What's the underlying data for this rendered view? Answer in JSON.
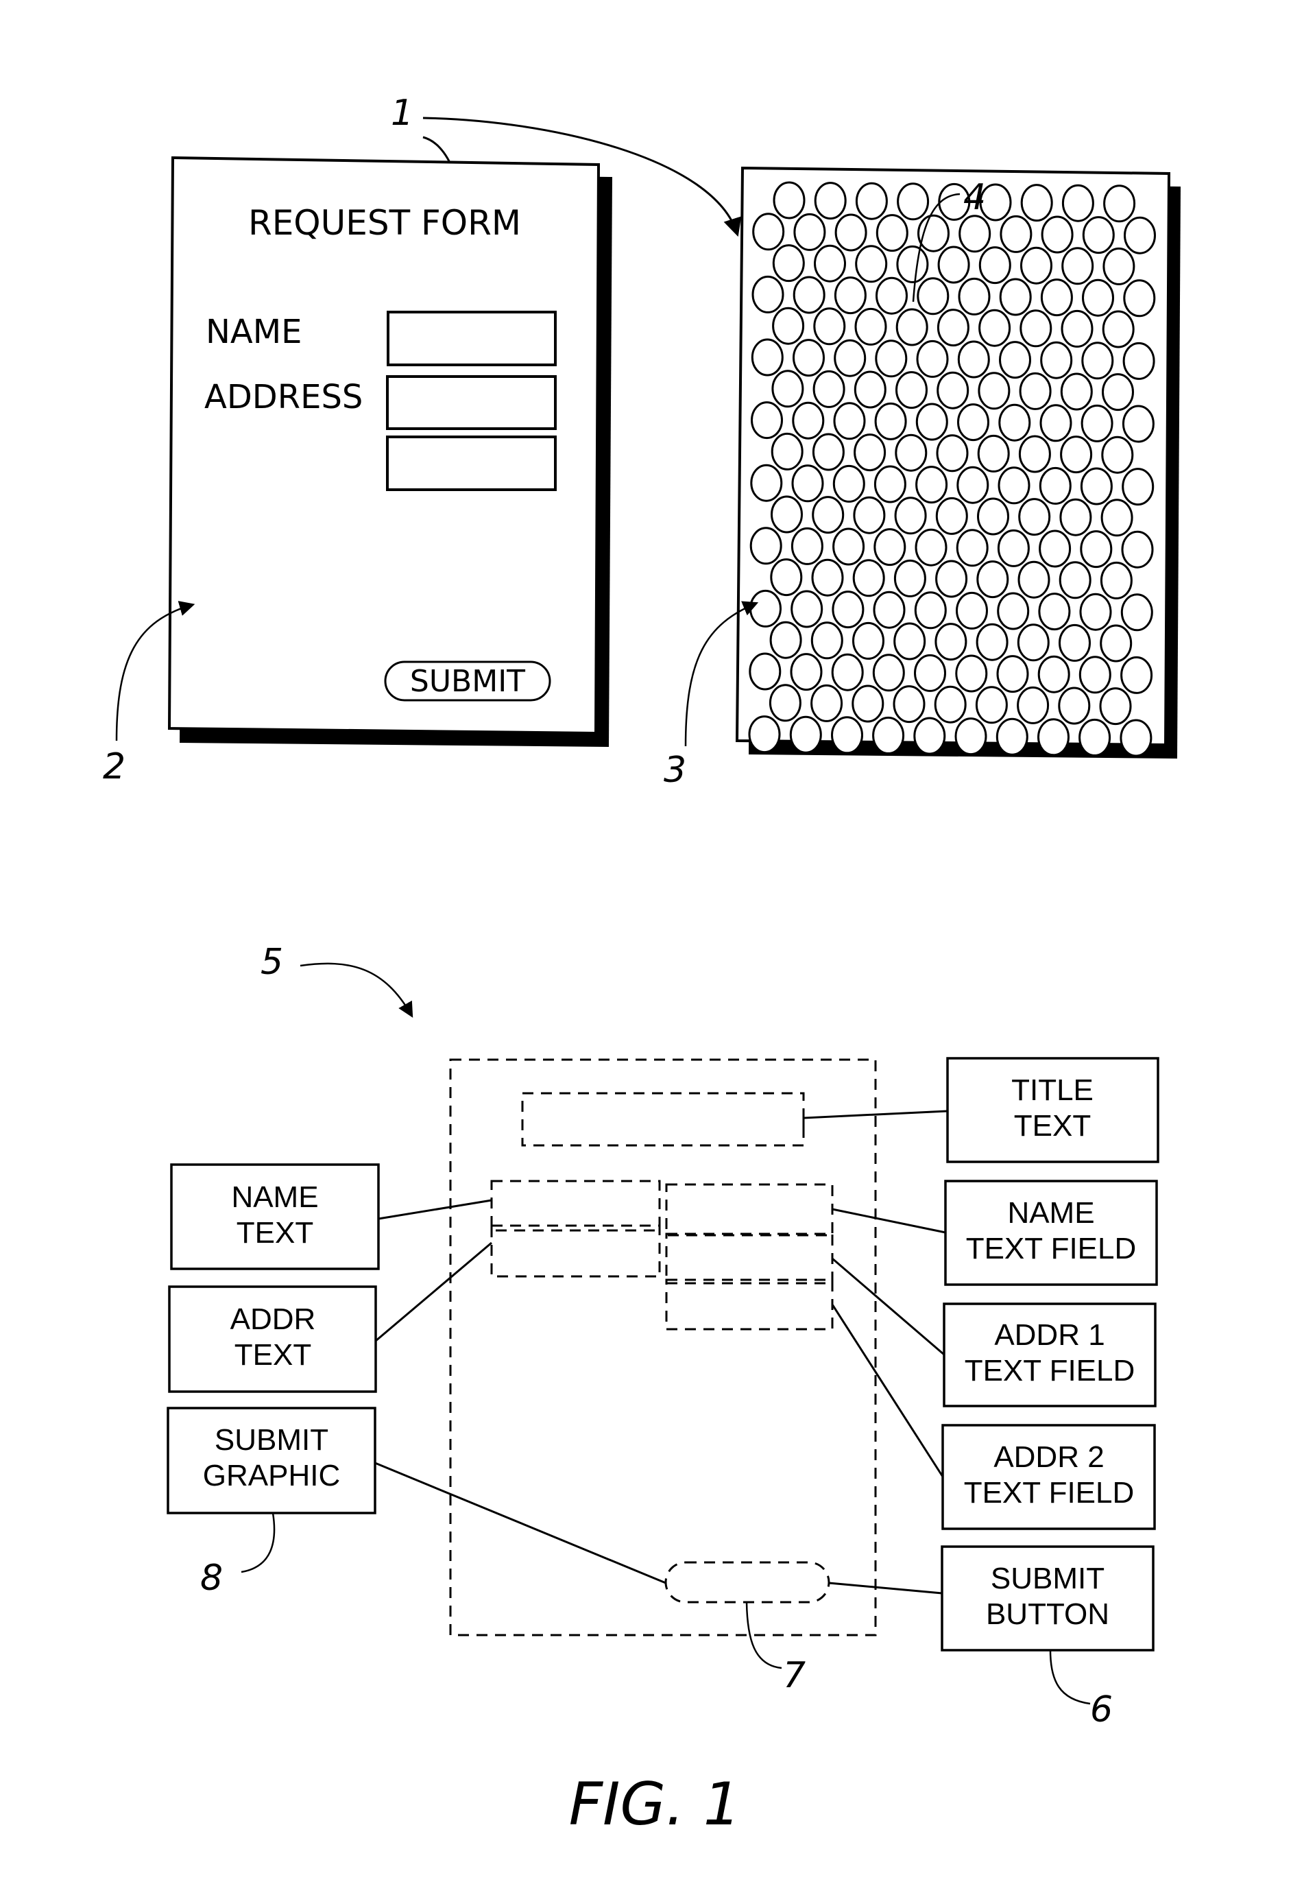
{
  "figure_label": "FIG. 1",
  "reference_numerals": {
    "forms_set": "1",
    "request_form": "2",
    "coded_page": "3",
    "coded_dot": "4",
    "form_layout": "5",
    "submit_button_ref": "6",
    "submit_zone_ref": "7",
    "submit_graphic_ref": "8"
  },
  "request_form": {
    "title": "REQUEST FORM",
    "name_label": "NAME",
    "address_label": "ADDRESS",
    "name_value": "",
    "address_line1_value": "",
    "address_line2_value": "",
    "submit_label": "SUBMIT"
  },
  "dot_pattern": {
    "rows": 18,
    "odd_row_count": 9,
    "even_row_count": 10
  },
  "layout_elements": {
    "left": [
      {
        "line1": "NAME",
        "line2": "TEXT"
      },
      {
        "line1": "ADDR",
        "line2": "TEXT"
      },
      {
        "line1": "SUBMIT",
        "line2": "GRAPHIC"
      }
    ],
    "right": [
      {
        "line1": "TITLE",
        "line2": "TEXT"
      },
      {
        "line1": "NAME",
        "line2": "TEXT FIELD"
      },
      {
        "line1": "ADDR 1",
        "line2": "TEXT FIELD"
      },
      {
        "line1": "ADDR 2",
        "line2": "TEXT FIELD"
      },
      {
        "line1": "SUBMIT",
        "line2": "BUTTON"
      }
    ]
  }
}
